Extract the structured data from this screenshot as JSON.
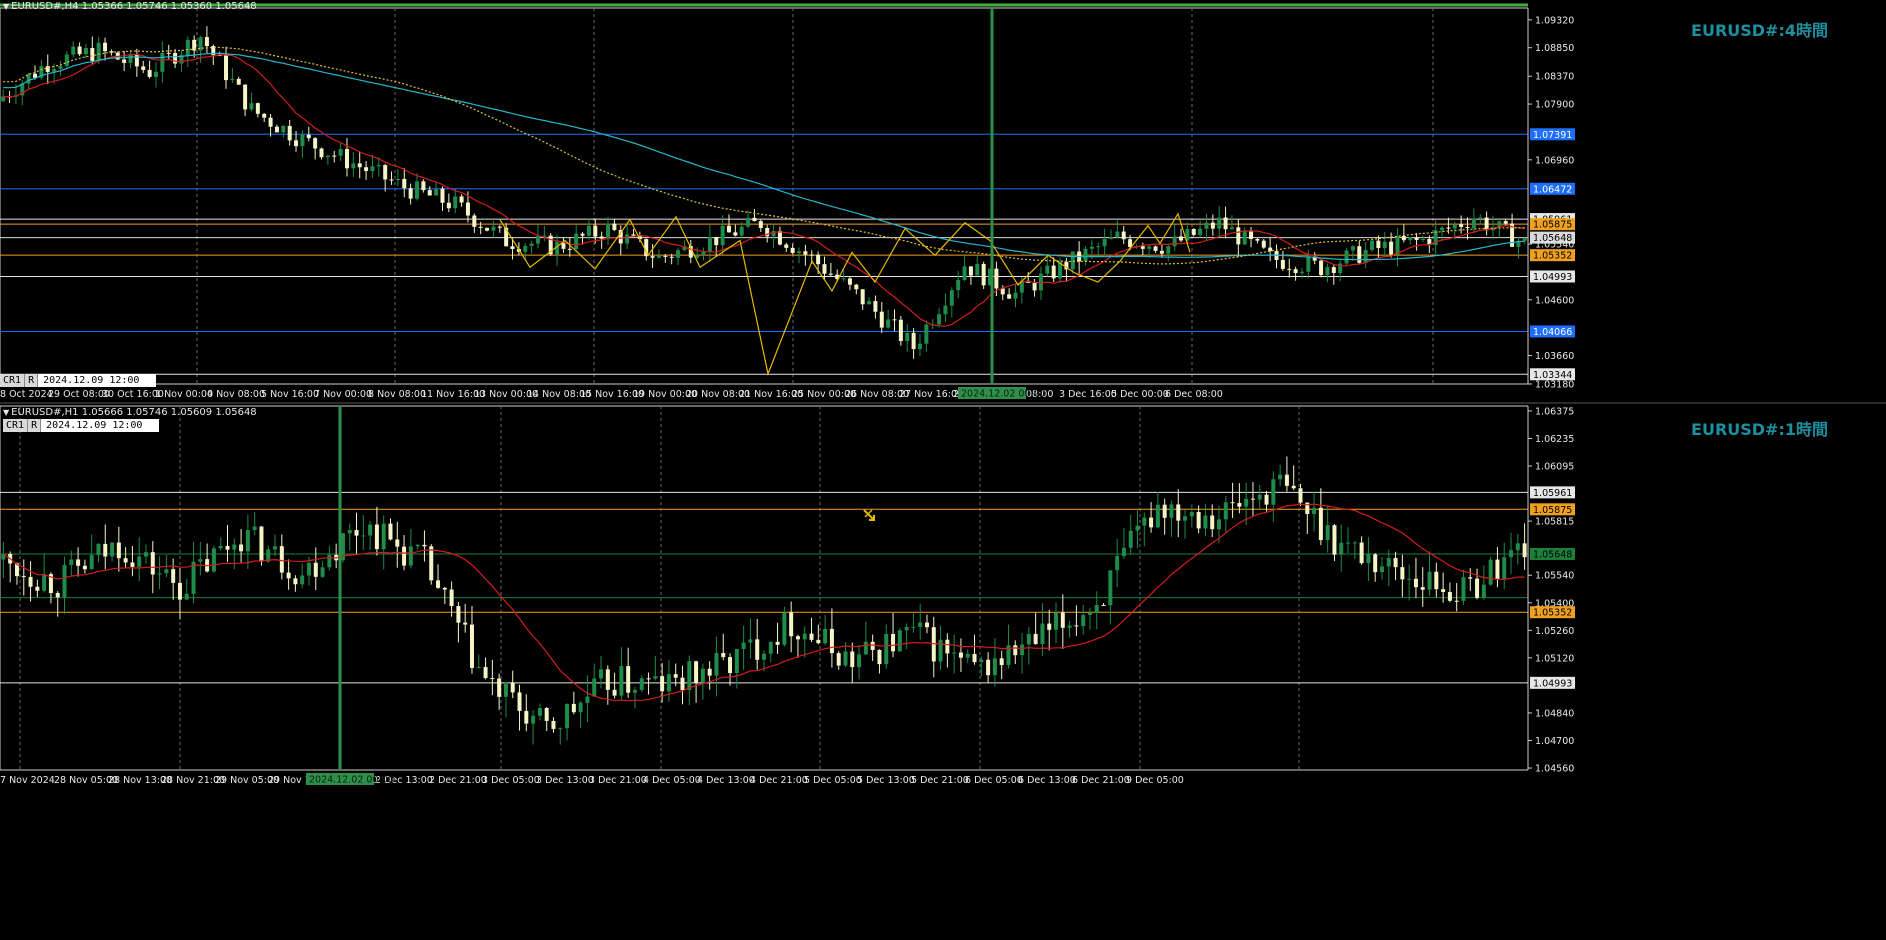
{
  "top": {
    "info": "EURUSD#,H4  1.05366 1.05746 1.05360 1.05648",
    "title": "EURUSD#:4時間",
    "cr": "CR1",
    "r": "R",
    "datetime": "2024.12.09 12:00",
    "price_labels": [
      "1.09320",
      "1.08850",
      "1.08370",
      "1.07900",
      "1.07391",
      "1.06960",
      "1.06472",
      "1.05961",
      "1.05875",
      "1.05648",
      "1.05540",
      "1.05352",
      "1.04993",
      "1.04600",
      "1.04066",
      "1.03660",
      "1.03344",
      "1.03180"
    ],
    "time_labels": [
      "8 Oct 2024",
      "29 Oct 08:00",
      "30 Oct 16:00",
      "1 Nov 00:00",
      "4 Nov 08:00",
      "5 Nov 16:00",
      "7 Nov 00:00",
      "8 Nov 08:00",
      "11 Nov 16:00",
      "13 Nov 00:00",
      "14 Nov 08:00",
      "15 Nov 16:00",
      "19 Nov 00:00",
      "20 Nov 08:00",
      "21 Nov 16:00",
      "25 Nov 00:00",
      "26 Nov 08:00",
      "27 Nov 16:00",
      "29",
      "08:00",
      "3 Dec 16:00",
      "5 Dec 00:00",
      "6 Dec 08:00"
    ],
    "cursor_time": "2024.12.02 00:00"
  },
  "bottom": {
    "info": "EURUSD#,H1  1.05666 1.05746 1.05609 1.05648",
    "title": "EURUSD#:1時間",
    "cr": "CR1",
    "r": "R",
    "datetime": "2024.12.09 12:00",
    "price_labels": [
      "1.06375",
      "1.06235",
      "1.06095",
      "1.05961",
      "1.05875",
      "1.05815",
      "1.05648",
      "1.05540",
      "1.05400",
      "1.05352",
      "1.05260",
      "1.05120",
      "1.04993",
      "1.04840",
      "1.04700",
      "1.04560"
    ],
    "time_labels": [
      "7 Nov 2024",
      "28 Nov 05:00",
      "28 Nov 13:00",
      "28 Nov 21:00",
      "29 Nov 05:00",
      "29 Nov 13:",
      "2 Dec 05:00",
      "2 Dec 13:00",
      "2 Dec 21:00",
      "3 Dec 05:00",
      "3 Dec 13:00",
      "3 Dec 21:00",
      "4 Dec 05:00",
      "4 Dec 13:00",
      "4 Dec 21:00",
      "5 Dec 05:00",
      "5 Dec 13:00",
      "5 Dec 21:00",
      "6 Dec 05:00",
      "6 Dec 13:00",
      "6 Dec 21:00",
      "9 Dec 05:00"
    ],
    "cursor_time": "2024.12.02 00:00"
  },
  "colors": {
    "background": "#000000",
    "bull": "#1e8c4a",
    "bear": "#f5f5c8",
    "ma_red": "#d01e1e",
    "ma_cyan": "#27b7c8",
    "ma_dotted": "#e0c040",
    "zigzag": "#e7b800",
    "cursor_line": "#2f8f4a",
    "hline_white": "#e6e6e6",
    "hline_orange": "#f0a020",
    "hline_blue": "#1e6fff",
    "hline_green": "#1e7f3a",
    "grid": "#6b6b6b",
    "title_teal": "#1f8fa0"
  }
}
